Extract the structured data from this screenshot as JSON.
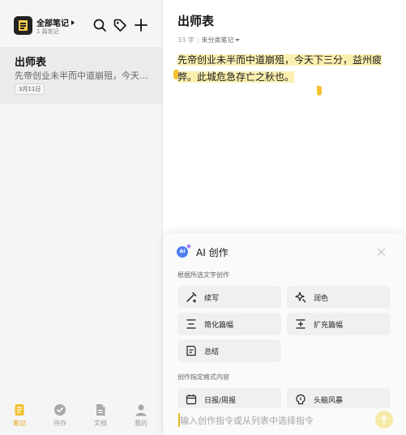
{
  "sidebar": {
    "folder_title": "全部笔记",
    "folder_count": "1 篇笔记",
    "note": {
      "title": "出师表",
      "snippet": "先帝创业未半而中道崩殂，今天下三分，益州疲弊。",
      "date": "3月11日"
    },
    "tabs": [
      {
        "label": "笔记",
        "icon": "note-icon",
        "active": true
      },
      {
        "label": "待办",
        "icon": "todo-check-icon",
        "active": false
      },
      {
        "label": "文档",
        "icon": "document-icon",
        "active": false
      },
      {
        "label": "我的",
        "icon": "profile-icon",
        "active": false
      }
    ]
  },
  "editor": {
    "title": "出师表",
    "word_count": "33 字",
    "category": "未分类笔记",
    "body": "先帝创业未半而中道崩殂，今天下三分，益州疲弊。此城危急存亡之秋也。"
  },
  "ai_panel": {
    "title": "AI 创作",
    "badge": "AI",
    "section1": "根据所选文字创作",
    "section2": "创作指定格式内容",
    "buttons": [
      {
        "label": "续写",
        "icon": "pen-continue-icon"
      },
      {
        "label": "润色",
        "icon": "sparkle-icon"
      },
      {
        "label": "简化篇幅",
        "icon": "shorten-icon"
      },
      {
        "label": "扩充篇幅",
        "icon": "expand-icon"
      },
      {
        "label": "总结",
        "icon": "summary-icon"
      },
      {
        "label": "日报/周报",
        "icon": "calendar-icon"
      },
      {
        "label": "头脑风暴",
        "icon": "brain-icon"
      }
    ],
    "input_placeholder": "输入创作指令或从列表中选择指令"
  },
  "colors": {
    "accent": "#f2c230",
    "highlight": "#fbefb0",
    "active_tab": "#e1a310",
    "ai_blue": "#4d7ef0"
  }
}
